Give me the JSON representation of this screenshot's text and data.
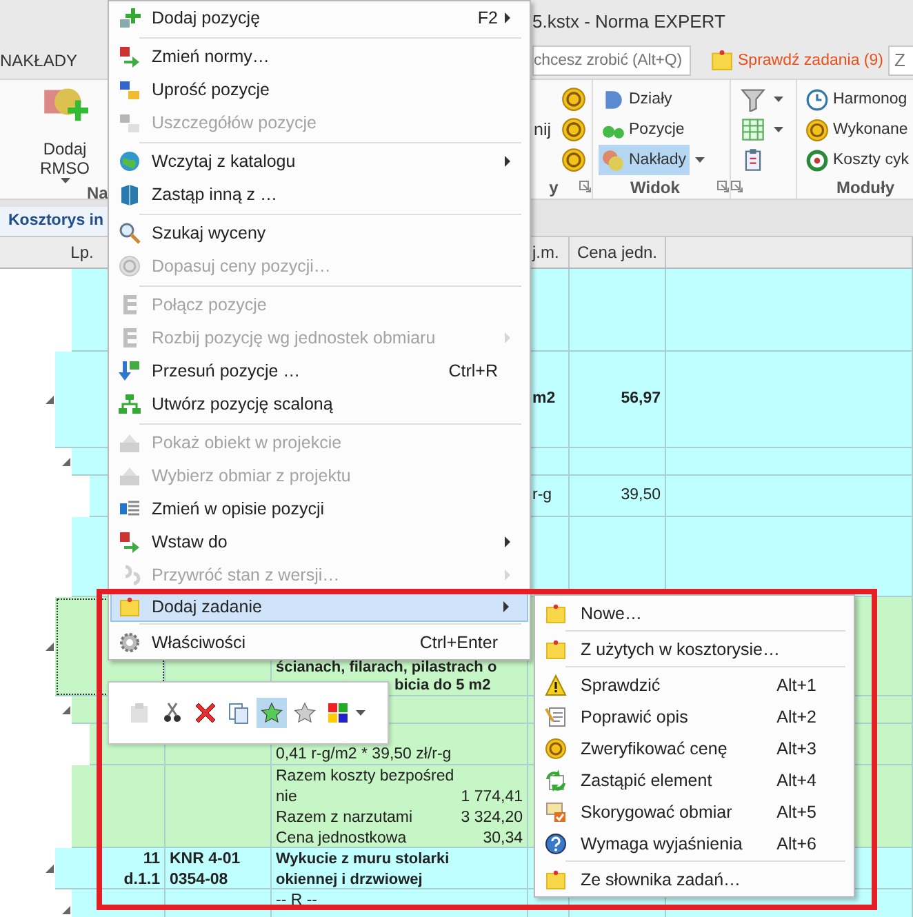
{
  "window": {
    "title": "5.kstx - Norma EXPERT"
  },
  "ribbon_tabs": [
    {
      "label": "NAKŁADY",
      "selected": false
    }
  ],
  "tell_me": {
    "placeholder": "chcesz zrobić (Alt+Q)"
  },
  "tasks_button": {
    "label": "Sprawdź zadania (9)"
  },
  "search_field": {
    "placeholder": "Z"
  },
  "ribbon_groups": [
    {
      "label": "Na",
      "columns": [
        [
          {
            "kind": "large",
            "label": "Dodaj RMSO",
            "dropdown": true
          }
        ]
      ]
    },
    {
      "label": "y",
      "launcher": true,
      "columns": [
        [
          {
            "kind": "text",
            "label": "nij"
          }
        ],
        [
          {
            "kind": "icon"
          },
          {
            "kind": "icon"
          },
          {
            "kind": "icon"
          }
        ]
      ]
    },
    {
      "label": "Widok",
      "launcher": true,
      "columns": [
        [
          {
            "kind": "small",
            "label": "Działy",
            "selected": false
          },
          {
            "kind": "small",
            "label": "Pozycje",
            "selected": false
          },
          {
            "kind": "small",
            "label": "Nakłady",
            "selected": true,
            "dropdown": true
          }
        ]
      ]
    },
    {
      "launcher": true,
      "columns": [
        [
          {
            "kind": "icon",
            "dropdown": true
          },
          {
            "kind": "icon",
            "dropdown": true
          },
          {
            "kind": "icon"
          }
        ]
      ]
    },
    {
      "label": "Moduły",
      "columns": [
        [
          {
            "kind": "small",
            "label": "Harmonog"
          },
          {
            "kind": "small",
            "label": "Wykonane"
          },
          {
            "kind": "small",
            "label": "Koszty cyk"
          }
        ]
      ]
    }
  ],
  "document_tabs": [
    {
      "label": "Kosztorys in",
      "selected": true
    }
  ],
  "grid": {
    "columns": [
      {
        "label": "Lp."
      },
      {
        "label": "j.m."
      },
      {
        "label": "Cena jedn."
      }
    ],
    "rows": [
      {
        "kind": "continuation",
        "children": [
          {
            "kind": "row",
            "color": "#c0ffff"
          }
        ]
      },
      {
        "kind": "row",
        "color": "#c0ffff",
        "expanded": true,
        "bold": true,
        "unit": "m2",
        "price": "56,97",
        "children": [
          {
            "kind": "row",
            "color": "#c0ffff",
            "expanded": true,
            "children": [
              {
                "kind": "row",
                "color": "#c0ffff",
                "unit": "r-g",
                "price": "39,50"
              }
            ]
          },
          {
            "kind": "row",
            "color": "#c0ffff"
          }
        ]
      },
      {
        "kind": "row",
        "color": "#c6f6c6",
        "expanded": true,
        "focused": true,
        "bold": true,
        "description": [
          "ścianach, filarach, pilastrach o"
        ],
        "description_tail": "bicia do 5 m2",
        "children": [
          {
            "kind": "row",
            "color": "#c6f6c6",
            "expanded": true,
            "children": [
              {
                "kind": "row",
                "color": "#c6f6c6",
                "description": [
                  "0,41 r-g/m2 * 39,50 zł/r-g"
                ]
              }
            ]
          },
          {
            "kind": "row",
            "color": "#c6f6c6",
            "summary": [
              {
                "label": "Razem koszty bezpośred"
              },
              {
                "label": "nie",
                "value": "1 774,41"
              },
              {
                "label": "Razem z narzutami",
                "value": "3 324,20"
              },
              {
                "label": "Cena jednostkowa",
                "value": "30,34"
              }
            ]
          }
        ]
      },
      {
        "kind": "row",
        "color": "#c0ffff",
        "expanded": true,
        "bold": true,
        "number": [
          "11",
          "d.1.1"
        ],
        "code": [
          "KNR 4-01",
          "0354-08"
        ],
        "description": [
          "Wykucie z muru stolarki",
          "okiennej i drzwiowej"
        ],
        "children": [
          {
            "kind": "row",
            "color": "#c0ffff",
            "expanded": true,
            "description": [
              "-- R --"
            ]
          }
        ]
      }
    ]
  },
  "context_menu": {
    "items": [
      {
        "kind": "item",
        "label": "Dodaj pozycję",
        "shortcut": "F2",
        "submenu": true,
        "disabled": false,
        "selected": false
      },
      {
        "kind": "separator"
      },
      {
        "kind": "item",
        "label": "Zmień normy…",
        "disabled": false,
        "selected": false
      },
      {
        "kind": "item",
        "label": "Uprość pozycje",
        "disabled": false,
        "selected": false
      },
      {
        "kind": "item",
        "label": "Uszczegółów pozycje",
        "disabled": true,
        "selected": false
      },
      {
        "kind": "separator"
      },
      {
        "kind": "item",
        "label": "Wczytaj z katalogu",
        "submenu": true,
        "disabled": false,
        "selected": false
      },
      {
        "kind": "item",
        "label": "Zastąp inną z …",
        "disabled": false,
        "selected": false
      },
      {
        "kind": "separator"
      },
      {
        "kind": "item",
        "label": "Szukaj wyceny",
        "disabled": false,
        "selected": false
      },
      {
        "kind": "item",
        "label": "Dopasuj ceny pozycji…",
        "disabled": true,
        "selected": false
      },
      {
        "kind": "separator"
      },
      {
        "kind": "item",
        "label": "Połącz pozycje",
        "disabled": true,
        "selected": false
      },
      {
        "kind": "item",
        "label": "Rozbij pozycję wg jednostek obmiaru",
        "submenu": true,
        "disabled": true,
        "selected": false
      },
      {
        "kind": "item",
        "label": "Przesuń pozycje …",
        "shortcut": "Ctrl+R",
        "disabled": false,
        "selected": false
      },
      {
        "kind": "item",
        "label": "Utwórz pozycję scaloną",
        "disabled": false,
        "selected": false
      },
      {
        "kind": "separator"
      },
      {
        "kind": "item",
        "label": "Pokaż obiekt w projekcie",
        "disabled": true,
        "selected": false
      },
      {
        "kind": "item",
        "label": "Wybierz obmiar z projektu",
        "disabled": true,
        "selected": false
      },
      {
        "kind": "item",
        "label": "Zmień w opisie pozycji",
        "disabled": false,
        "selected": false
      },
      {
        "kind": "item",
        "label": "Wstaw do",
        "submenu": true,
        "disabled": false,
        "selected": false
      },
      {
        "kind": "item",
        "label": "Przywróć stan z wersji…",
        "submenu": true,
        "disabled": true,
        "selected": false
      },
      {
        "kind": "item",
        "label": "Dodaj zadanie",
        "submenu": true,
        "disabled": false,
        "selected": true
      },
      {
        "kind": "separator"
      },
      {
        "kind": "item",
        "label": "Właściwości",
        "shortcut": "Ctrl+Enter",
        "disabled": false,
        "selected": false
      }
    ]
  },
  "task_submenu": {
    "items": [
      {
        "kind": "item",
        "label": "Nowe…",
        "disabled": false,
        "selected": false
      },
      {
        "kind": "separator"
      },
      {
        "kind": "item",
        "label": "Z użytych w kosztorysie…",
        "disabled": false,
        "selected": false
      },
      {
        "kind": "separator"
      },
      {
        "kind": "item",
        "label": "Sprawdzić",
        "shortcut": "Alt+1",
        "disabled": false,
        "selected": false
      },
      {
        "kind": "item",
        "label": "Poprawić opis",
        "shortcut": "Alt+2",
        "disabled": false,
        "selected": false
      },
      {
        "kind": "item",
        "label": "Zweryfikować cenę",
        "shortcut": "Alt+3",
        "disabled": false,
        "selected": false
      },
      {
        "kind": "item",
        "label": "Zastąpić element",
        "shortcut": "Alt+4",
        "disabled": false,
        "selected": false
      },
      {
        "kind": "item",
        "label": "Skorygować obmiar",
        "shortcut": "Alt+5",
        "disabled": false,
        "selected": false
      },
      {
        "kind": "item",
        "label": "Wymaga wyjaśnienia",
        "shortcut": "Alt+6",
        "disabled": false,
        "selected": false
      },
      {
        "kind": "separator"
      },
      {
        "kind": "item",
        "label": "Ze słownika zadań…",
        "disabled": false,
        "selected": false
      }
    ]
  },
  "mini_toolbar": {
    "buttons": [
      {
        "disabled": true,
        "selected": false
      },
      {
        "disabled": false,
        "selected": false
      },
      {
        "disabled": false,
        "selected": false
      },
      {
        "disabled": false,
        "selected": false
      },
      {
        "disabled": false,
        "selected": true
      },
      {
        "disabled": false,
        "selected": false
      },
      {
        "disabled": false,
        "selected": false,
        "dropdown": true
      }
    ]
  }
}
